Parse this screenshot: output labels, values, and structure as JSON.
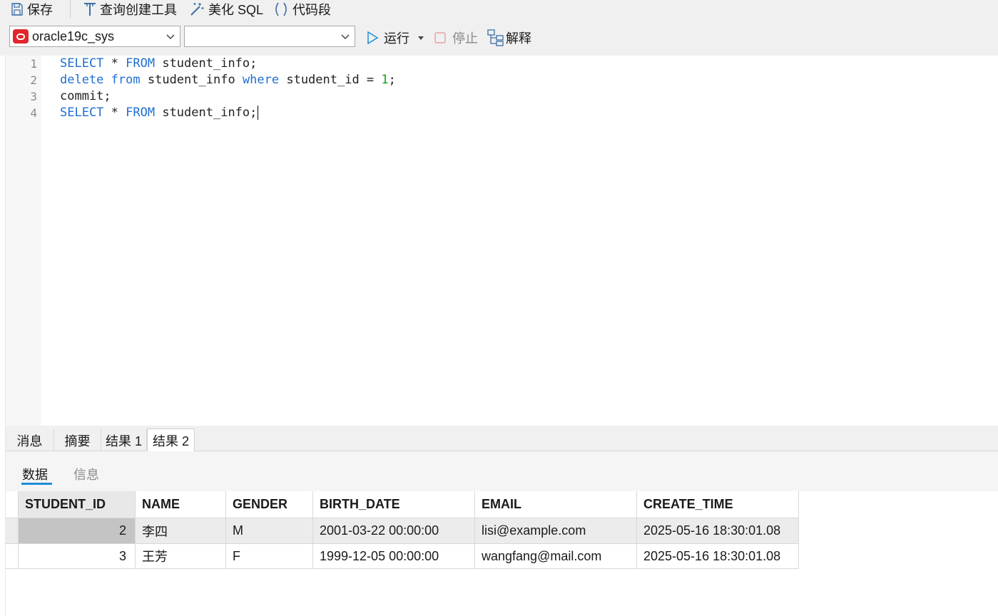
{
  "toolbar": {
    "save_label": "保存",
    "query_builder_label": "查询创建工具",
    "beautify_label": "美化 SQL",
    "snippet_label": "代码段"
  },
  "connection": {
    "name": "oracle19c_sys",
    "schema": ""
  },
  "actions": {
    "run_label": "运行",
    "stop_label": "停止",
    "explain_label": "解释"
  },
  "editor": {
    "line_numbers": [
      "1",
      "2",
      "3",
      "4"
    ]
  },
  "result_tabs": [
    "消息",
    "摘要",
    "结果 1",
    "结果 2"
  ],
  "active_result_tab": "结果 2",
  "sub_tabs": [
    "数据",
    "信息"
  ],
  "table": {
    "columns": [
      "STUDENT_ID",
      "NAME",
      "GENDER",
      "BIRTH_DATE",
      "EMAIL",
      "CREATE_TIME"
    ],
    "rows": [
      [
        "2",
        "李四",
        "M",
        "2001-03-22 00:00:00",
        "lisi@example.com",
        "2025-05-16 18:30:01.08"
      ],
      [
        "3",
        "王芳",
        "F",
        "1999-12-05 00:00:00",
        "wangfang@mail.com",
        "2025-05-16 18:30:01.08"
      ]
    ]
  }
}
